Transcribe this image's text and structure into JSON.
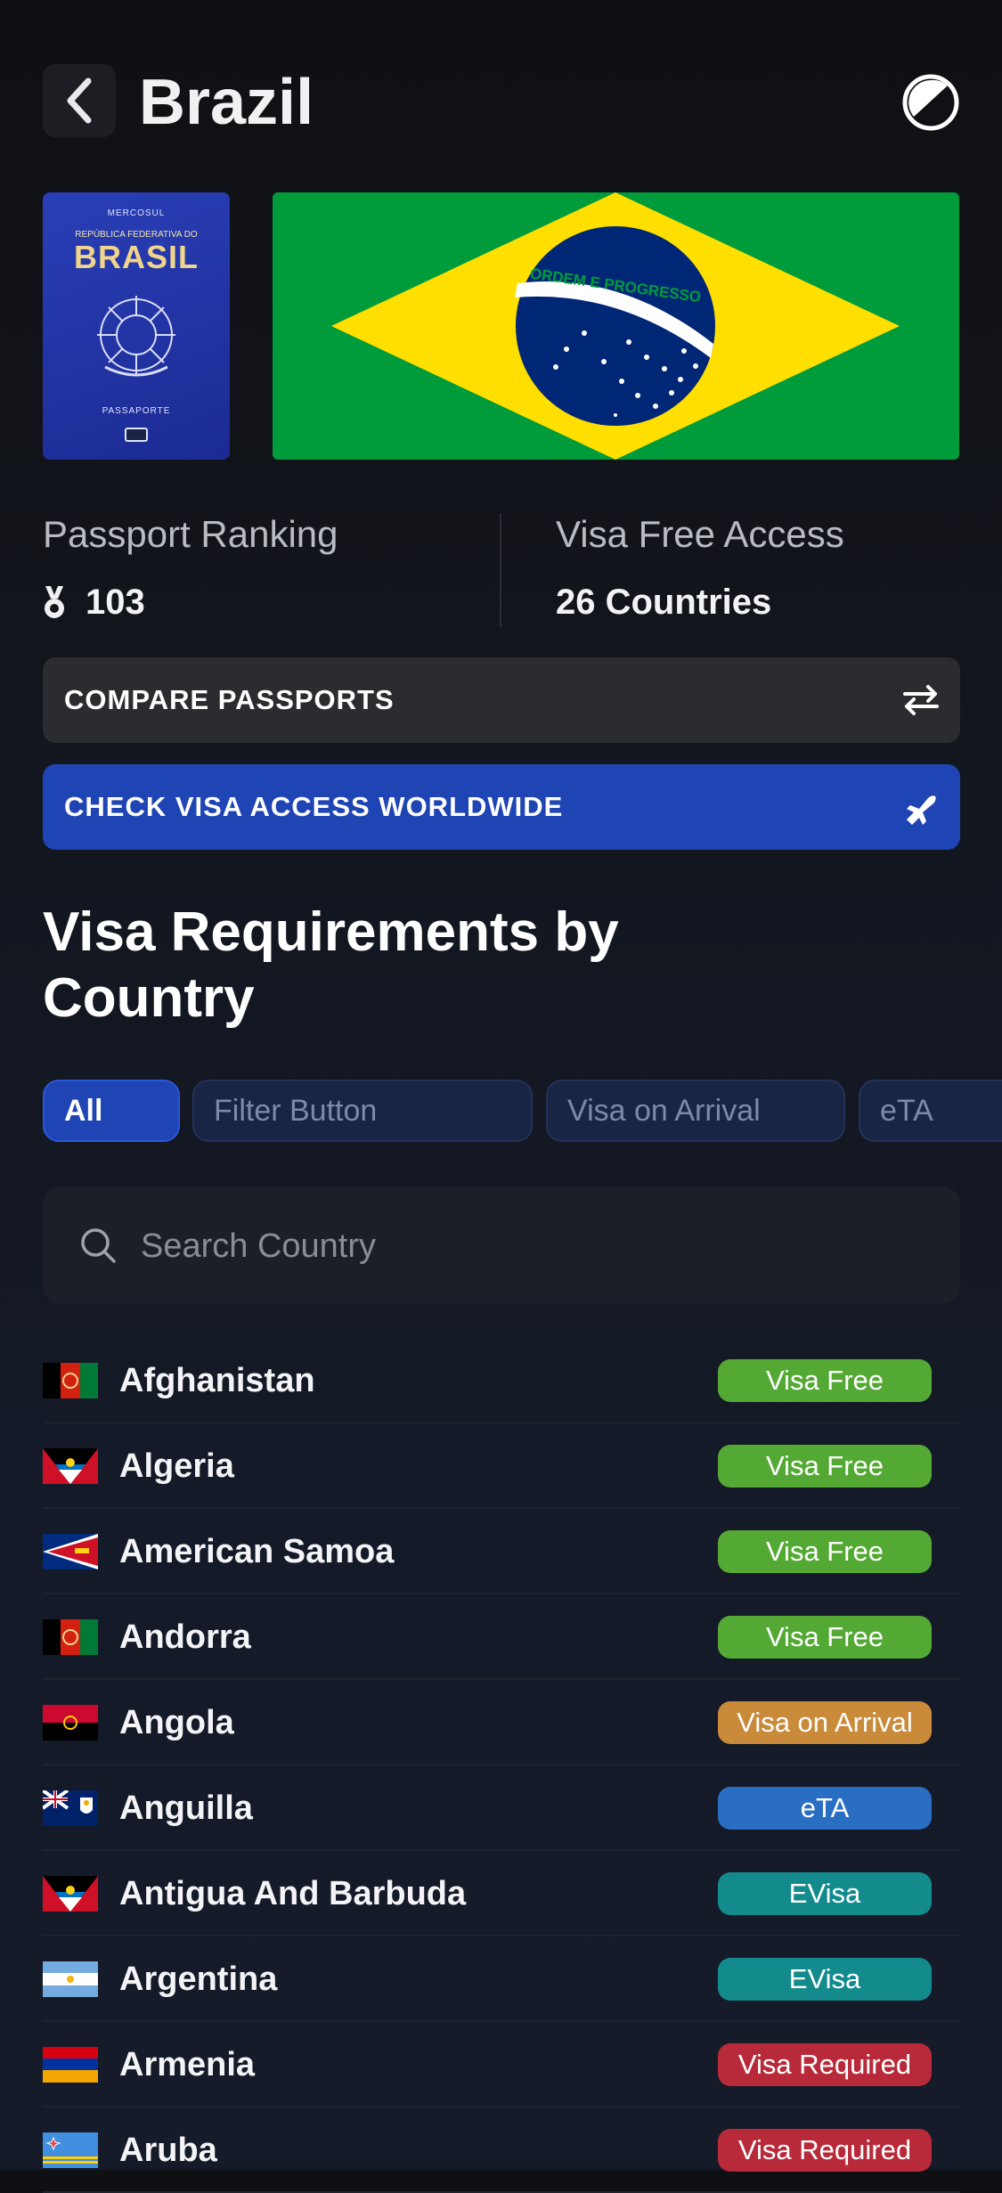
{
  "header": {
    "title": "Brazil",
    "back_icon": "chevron-left-icon",
    "theme_icon": "contrast-icon"
  },
  "passport": {
    "mercosul": "MERCOSUL",
    "republic": "REPÚBLICA FEDERATIVA DO",
    "country": "BRASIL",
    "label": "PASSAPORTE"
  },
  "flag": {
    "motto": "ORDEM E PROGRESSO",
    "colors": {
      "green": "#009b3a",
      "yellow": "#fedf00",
      "blue": "#002776"
    }
  },
  "stats": {
    "ranking_label": "Passport Ranking",
    "ranking_value": "103",
    "ranking_icon": "medal-icon",
    "visa_free_label": "Visa Free Access",
    "visa_free_value": "26 Countries"
  },
  "buttons": {
    "compare": "COMPARE PASSPORTS",
    "check": "CHECK VISA ACCESS WORLDWIDE"
  },
  "section": {
    "title_line1": "Visa Requirements by",
    "title_line2": "Country"
  },
  "filters": [
    "All",
    "Filter Button",
    "Visa on Arrival",
    "eTA"
  ],
  "search": {
    "placeholder": "Search Country"
  },
  "status_colors": {
    "Visa Free": "#54a935",
    "Visa on Arrival": "#c98a3a",
    "eTA": "#2a6ec3",
    "EVisa": "#138b8d",
    "Visa Required": "#b82a3a"
  },
  "countries": [
    {
      "name": "Afghanistan",
      "status": "Visa Free",
      "flag": "afghanistan"
    },
    {
      "name": "Algeria",
      "status": "Visa Free",
      "flag": "antigua"
    },
    {
      "name": "American Samoa",
      "status": "Visa Free",
      "flag": "samoa"
    },
    {
      "name": "Andorra",
      "status": "Visa Free",
      "flag": "afghanistan"
    },
    {
      "name": "Angola",
      "status": "Visa on Arrival",
      "flag": "angola"
    },
    {
      "name": "Anguilla",
      "status": "eTA",
      "flag": "anguilla"
    },
    {
      "name": "Antigua And Barbuda",
      "status": "EVisa",
      "flag": "antigua"
    },
    {
      "name": "Argentina",
      "status": "EVisa",
      "flag": "argentina"
    },
    {
      "name": "Armenia",
      "status": "Visa Required",
      "flag": "armenia"
    },
    {
      "name": "Aruba",
      "status": "Visa Required",
      "flag": "aruba"
    }
  ]
}
